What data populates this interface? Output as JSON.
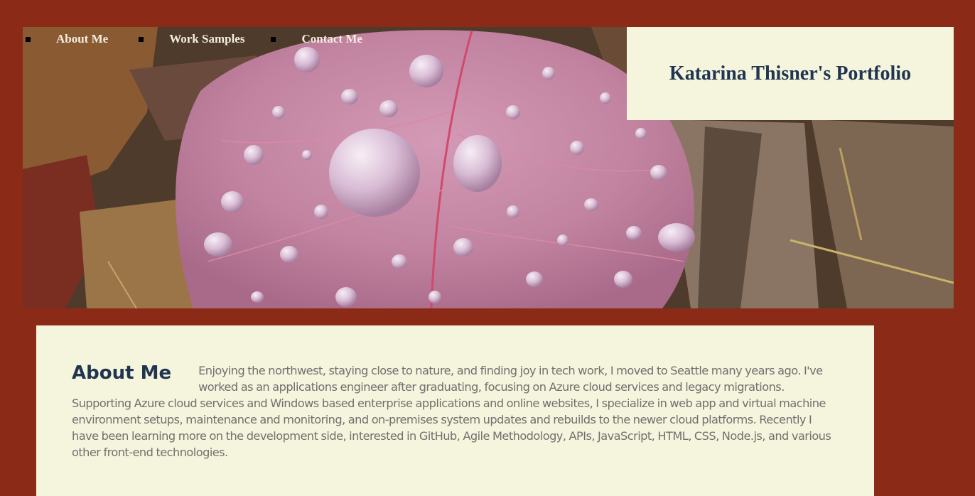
{
  "nav": {
    "items": [
      {
        "label": "About Me"
      },
      {
        "label": "Work Samples"
      },
      {
        "label": "Contact Me"
      }
    ]
  },
  "header": {
    "title": "Katarina Thisner's Portfolio"
  },
  "about": {
    "heading": "About Me",
    "body": "Enjoying the northwest, staying close to nature, and finding joy in tech work, I moved to Seattle many years ago. I've worked as an applications engineer after graduating, focusing on Azure cloud services and legacy migrations. Supporting Azure cloud services and Windows based enterprise applications and online websites, I specialize in web app and virtual machine environment setups, maintenance and monitoring, and on-premises system updates and rebuilds to the newer cloud platforms. Recently I have been learning more on the development side, interested in GitHub, Agile Methodology, APIs, JavaScript, HTML, CSS, Node.js, and various other front-end technologies."
  },
  "colors": {
    "page_background": "#8b2a17",
    "panel_background": "#f5f4dc",
    "heading_color": "#1f3550",
    "body_text_color": "#707070",
    "leaf_color": "#c98aa6"
  },
  "hero_image": {
    "subject": "leaf-with-water-drops-photo"
  }
}
